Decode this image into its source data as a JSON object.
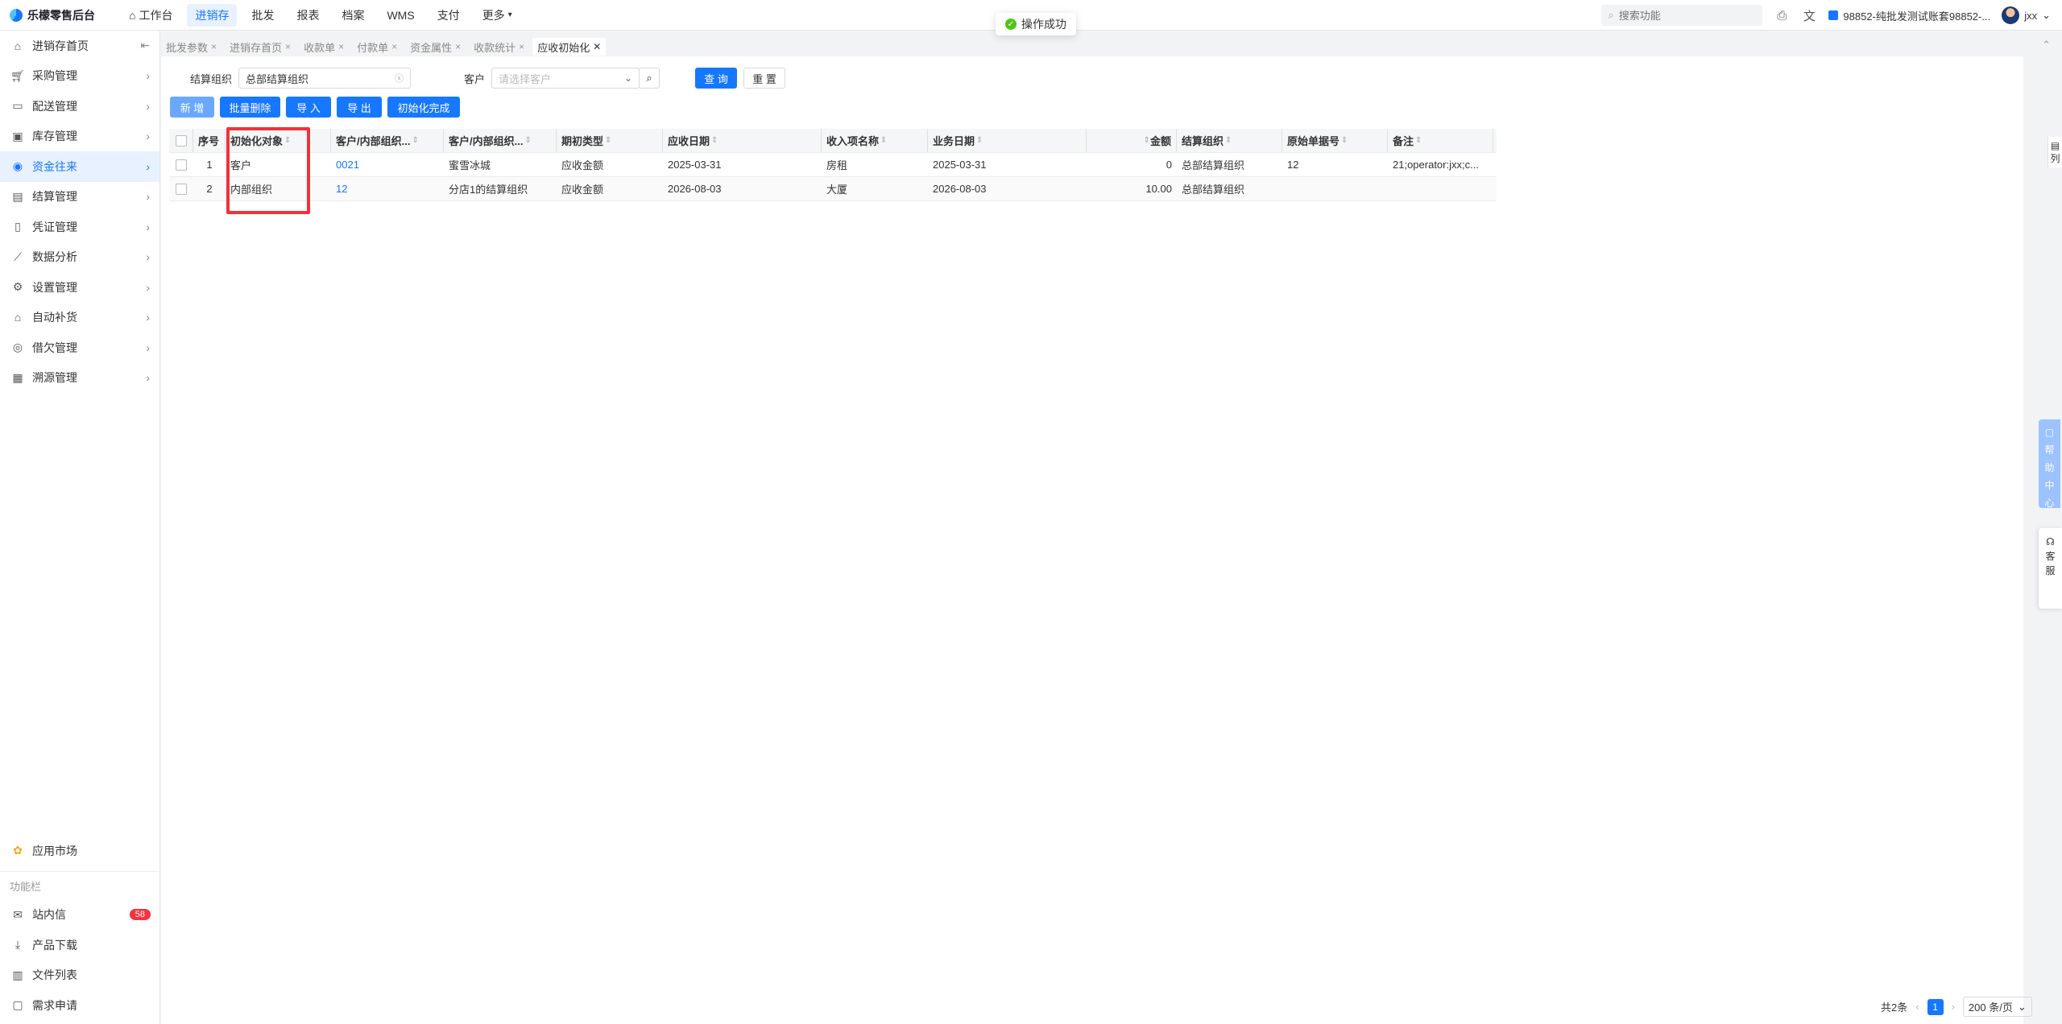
{
  "app": {
    "title": "乐檬零售后台"
  },
  "topnav": [
    {
      "label": "工作台",
      "icon": "home-icon"
    },
    {
      "label": "进销存",
      "active": true
    },
    {
      "label": "批发"
    },
    {
      "label": "报表"
    },
    {
      "label": "档案"
    },
    {
      "label": "WMS"
    },
    {
      "label": "支付"
    },
    {
      "label": "更多"
    }
  ],
  "toast": {
    "text": "操作成功"
  },
  "top_right": {
    "search_placeholder": "搜索功能",
    "org": "98852-纯批发测试账套98852-...",
    "user": "jxx"
  },
  "sidebar": {
    "items": [
      {
        "label": "进销存首页",
        "icon": "home-icon"
      },
      {
        "label": "采购管理",
        "icon": "cart-icon"
      },
      {
        "label": "配送管理",
        "icon": "truck-icon"
      },
      {
        "label": "库存管理",
        "icon": "box-icon"
      },
      {
        "label": "资金往来",
        "icon": "money-icon",
        "active": true
      },
      {
        "label": "结算管理",
        "icon": "settlement-icon"
      },
      {
        "label": "凭证管理",
        "icon": "voucher-icon"
      },
      {
        "label": "数据分析",
        "icon": "chart-icon"
      },
      {
        "label": "设置管理",
        "icon": "gear-icon"
      },
      {
        "label": "自动补货",
        "icon": "replenish-icon"
      },
      {
        "label": "借欠管理",
        "icon": "coin-icon"
      },
      {
        "label": "溯源管理",
        "icon": "trace-icon"
      }
    ],
    "app_market": "应用市场",
    "section_title": "功能栏",
    "bottom_items": [
      {
        "label": "站内信",
        "icon": "mail-icon",
        "badge": "58"
      },
      {
        "label": "产品下载",
        "icon": "download-icon"
      },
      {
        "label": "文件列表",
        "icon": "file-icon"
      },
      {
        "label": "需求申请",
        "icon": "request-icon"
      }
    ]
  },
  "tabs": [
    {
      "label": "批发参数"
    },
    {
      "label": "进销存首页"
    },
    {
      "label": "收款单"
    },
    {
      "label": "付款单"
    },
    {
      "label": "资金属性"
    },
    {
      "label": "收款统计"
    },
    {
      "label": "应收初始化",
      "active": true
    }
  ],
  "filters": {
    "org_label": "结算组织",
    "org_value": "总部结算组织",
    "customer_label": "客户",
    "customer_placeholder": "请选择客户",
    "query": "查 询",
    "reset": "重 置"
  },
  "toolbar": {
    "add": "新 增",
    "batch_delete": "批量删除",
    "import": "导 入",
    "export": "导 出",
    "init_done": "初始化完成"
  },
  "table": {
    "headers": [
      "序号",
      "初始化对象",
      "客户/内部组织...",
      "客户/内部组织...",
      "期初类型",
      "应收日期",
      "收入项名称",
      "业务日期",
      "",
      "金额",
      "结算组织",
      "原始单据号",
      "备注"
    ],
    "rows": [
      [
        "1",
        "客户",
        "0021",
        "蜜雪冰城",
        "应收金额",
        "2025-03-31",
        "房租",
        "2025-03-31",
        "",
        "0",
        "总部结算组织",
        "12",
        "21;operator:jxx;c..."
      ],
      [
        "2",
        "内部组织",
        "12",
        "分店1的结算组织",
        "应收金额",
        "2026-08-03",
        "大厦",
        "2026-08-03",
        "",
        "10.00",
        "总部结算组织",
        "",
        ""
      ]
    ]
  },
  "right_panel": {
    "columns": "列",
    "help_center": [
      "帮",
      "助",
      "中",
      "心"
    ],
    "customer_service": [
      "客",
      "服"
    ]
  },
  "pager": {
    "total": "共2条",
    "page": "1",
    "size": "200 条/页"
  }
}
